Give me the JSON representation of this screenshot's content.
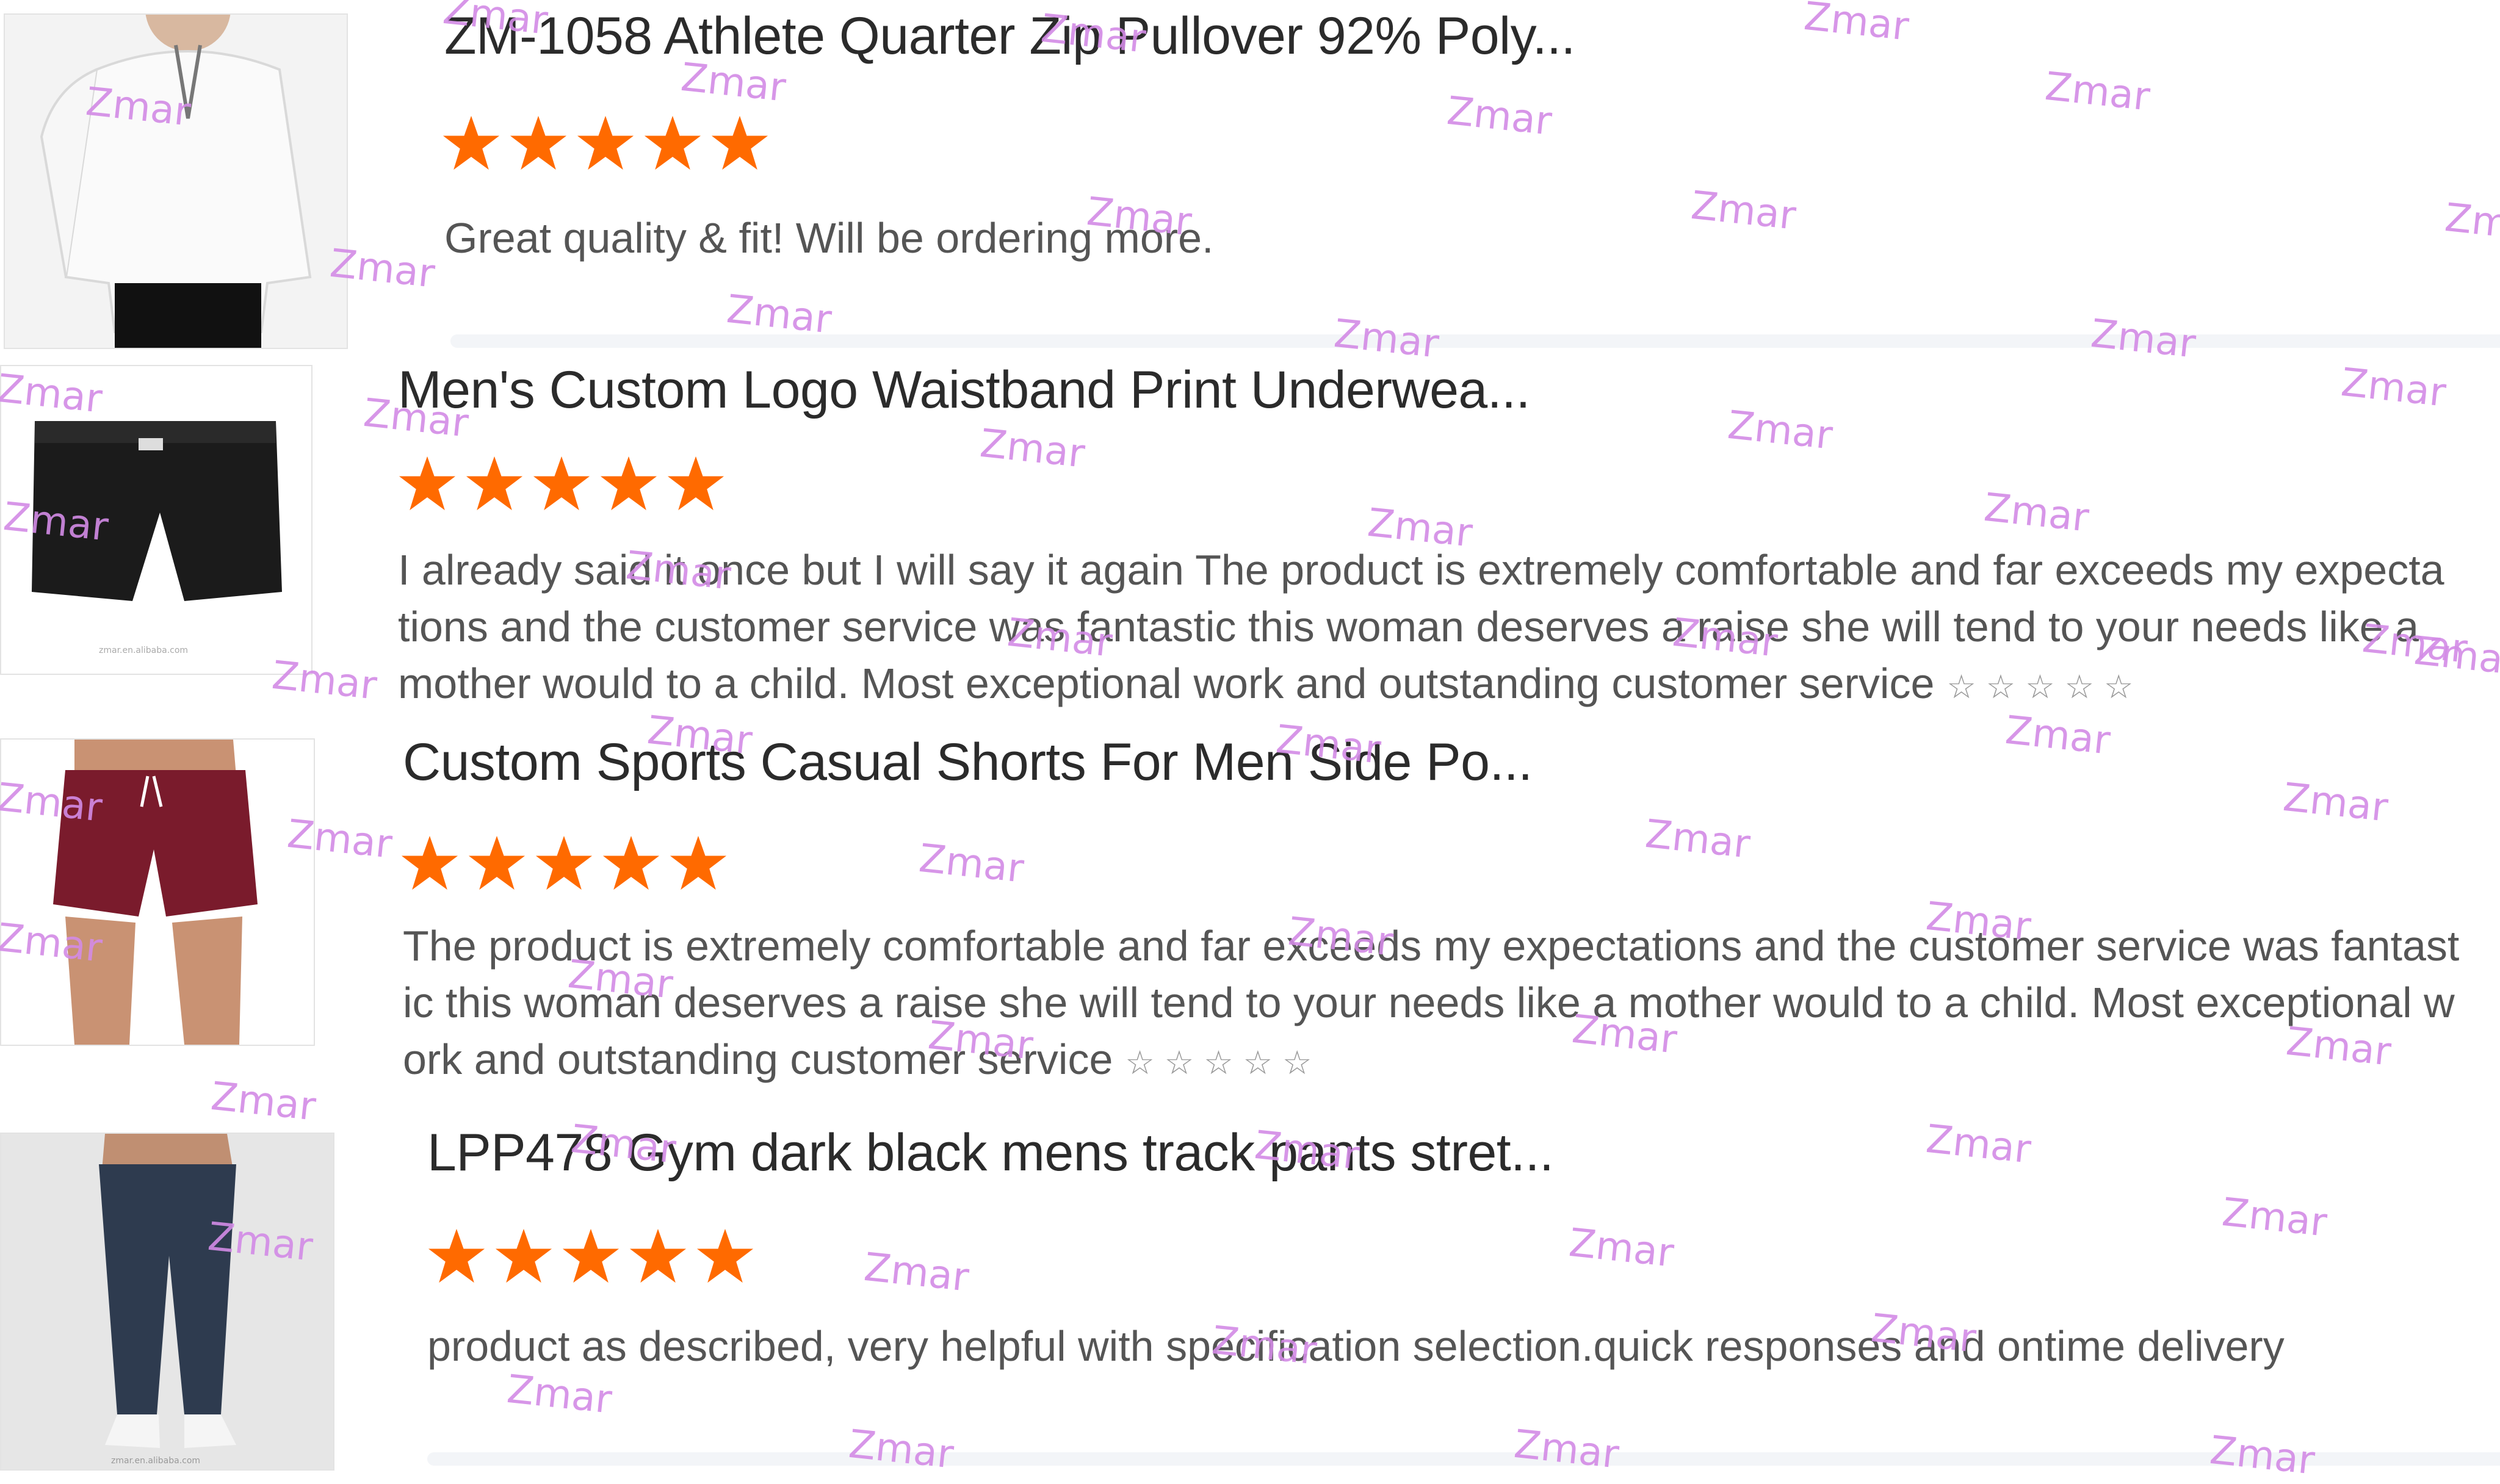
{
  "reviews": [
    {
      "title": "ZM-1058 Athlete Quarter Zip Pullover 92% Poly...",
      "rating": 5,
      "text": "Great quality & fit! Will be ordering more.",
      "image_icon": "white-quarter-zip-pullover-photo"
    },
    {
      "title": "Men's Custom Logo Waistband Print Underwea...",
      "rating": 5,
      "text": "I already said it once but I will say it again The product is extremely comfortable and far exceeds my expectations and the customer service was fantastic this woman deserves a raise she will tend to your needs like a mother would to a child. Most exceptional work and outstanding customer service",
      "trailing_stars": "☆☆☆☆☆",
      "image_icon": "black-boxer-brief-photo"
    },
    {
      "title": "Custom Sports Casual Shorts For Men Side Po...",
      "rating": 5,
      "text": "The product is extremely comfortable and far exceeds my expectations and the customer service was fantastic this woman deserves a raise she will tend to your needs like a mother would to a child. Most exceptional work and outstanding customer service",
      "trailing_stars": "☆☆☆☆☆",
      "image_icon": "maroon-shorts-photo"
    },
    {
      "title": "LPP478 Gym dark black mens track pants stret...",
      "rating": 5,
      "text": "product as described, very helpful with specification selection.quick responses and ontime delivery",
      "image_icon": "navy-track-pants-photo"
    }
  ],
  "watermark": "Zmar",
  "colors": {
    "star": "#ff6a00",
    "title": "#2b2b2b",
    "text": "#555555",
    "watermark": "#d38be6"
  }
}
